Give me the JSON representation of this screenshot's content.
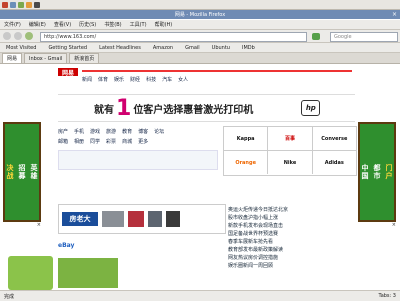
{
  "window": {
    "title": "网易 - Mozilla Firefox",
    "url": "http://www.163.com/",
    "search_placeholder": "Google"
  },
  "menu": [
    "文件(F)",
    "编辑(E)",
    "查看(V)",
    "历史(S)",
    "书签(B)",
    "工具(T)",
    "帮助(H)"
  ],
  "bookmarks": [
    "Most Visited",
    "Getting Started",
    "Latest Headlines",
    "Amazon",
    "Gmail",
    "Ubuntu",
    "IMDb"
  ],
  "tabs": [
    {
      "label": "网易"
    },
    {
      "label": "Inbox - Gmail"
    },
    {
      "label": "新浪首页"
    }
  ],
  "page": {
    "logo": "网易",
    "banner_prefix": "就有",
    "banner_number": "1",
    "banner_suffix": "位客户选择惠普激光打印机",
    "hp_logo": "hp",
    "nav_rows": [
      [
        "新闻",
        "体育",
        "娱乐",
        "财经",
        "科技",
        "汽车",
        "女人"
      ],
      [
        "房产",
        "手机",
        "游戏",
        "旅游",
        "教育",
        "博客",
        "论坛"
      ],
      [
        "邮箱",
        "相册",
        "同学",
        "彩票",
        "商城",
        "更多"
      ]
    ],
    "brands": [
      "Kappa",
      "百事",
      "Converse",
      "Orange",
      "Nike",
      "Adidas"
    ],
    "fanglao": "房老大",
    "news": [
      "奥运火炬传递今日抵达北京",
      "股市收盘沪指小幅上涨",
      "新款手机发布会现场直击",
      "国足备战世界杯预选赛",
      "春季车展新车抢先看",
      "教育部发布最新政策解读",
      "网友热议房价调控措施",
      "娱乐圈新闻一周回顾"
    ],
    "ebay": "eBay"
  },
  "left_ad": {
    "line1": "招募",
    "line2": "英雄",
    "line3": "决战",
    "close": "×"
  },
  "right_ad": {
    "line1": "都市",
    "line2": "门户",
    "line3": "中国",
    "close": "×"
  },
  "status": {
    "text": "完成",
    "right": "Tabs: 3"
  }
}
